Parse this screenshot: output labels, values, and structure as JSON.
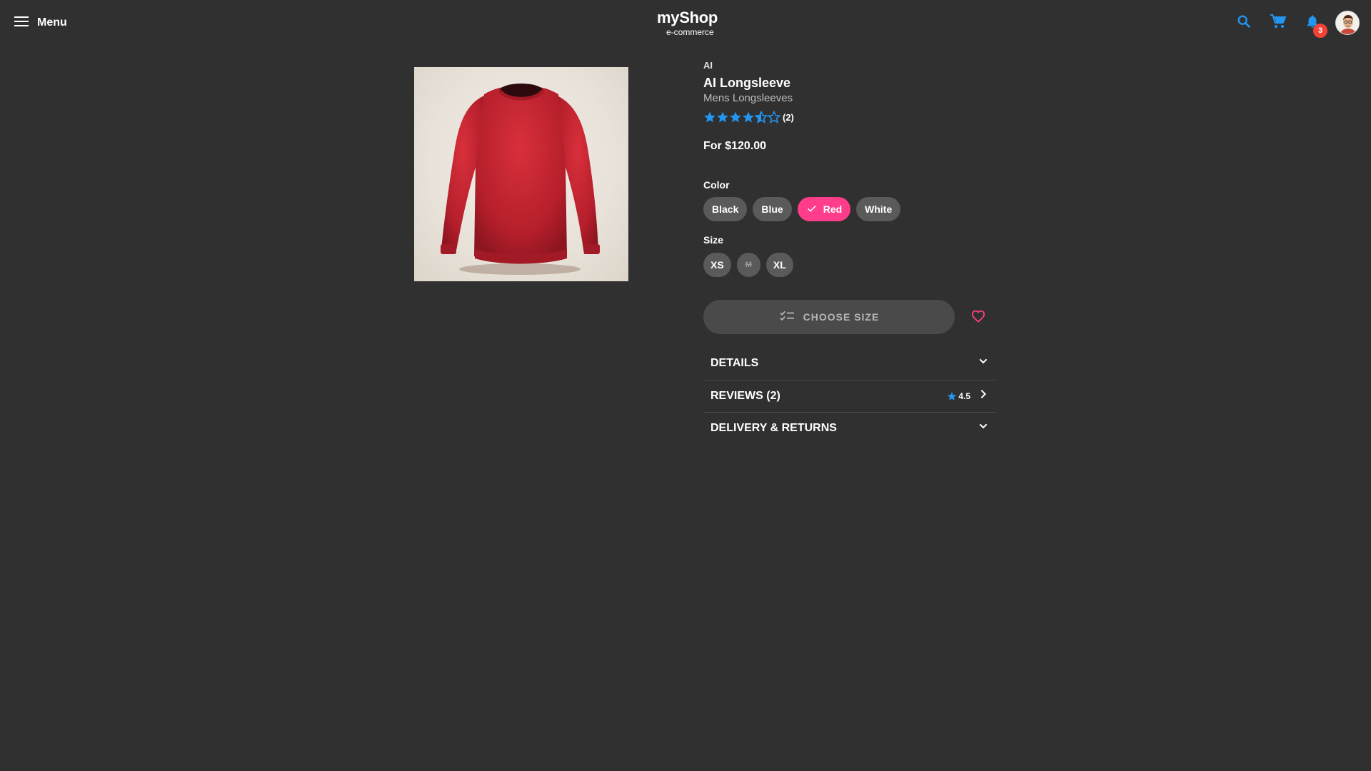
{
  "header": {
    "menu_label": "Menu",
    "brand_name": "myShop",
    "brand_sub": "e-commerce",
    "notification_count": "3",
    "accent_color": "#2196f3"
  },
  "product": {
    "brand": "AI",
    "title": "AI Longsleeve",
    "category": "Mens Longsleeves",
    "rating": 3.5,
    "rating_max": 5,
    "review_count_label": "(2)",
    "price": "For $120.00",
    "image_alt": "red longsleeve shirt"
  },
  "options": {
    "color_label": "Color",
    "colors": [
      {
        "label": "Black",
        "selected": false
      },
      {
        "label": "Blue",
        "selected": false
      },
      {
        "label": "Red",
        "selected": true
      },
      {
        "label": "White",
        "selected": false
      }
    ],
    "size_label": "Size",
    "sizes": [
      {
        "label": "XS",
        "available": true
      },
      {
        "label": "M",
        "available": false
      },
      {
        "label": "XL",
        "available": true
      }
    ],
    "selected_color_hex": "#ff3d8a"
  },
  "actions": {
    "choose_size_label": "CHOOSE SIZE"
  },
  "sections": [
    {
      "title": "DETAILS",
      "icon": "chevron-down-icon"
    },
    {
      "title": "REVIEWS (2)",
      "icon": "chevron-right-icon",
      "rating": "4.5"
    },
    {
      "title": "DELIVERY & RETURNS",
      "icon": "chevron-down-icon"
    }
  ]
}
